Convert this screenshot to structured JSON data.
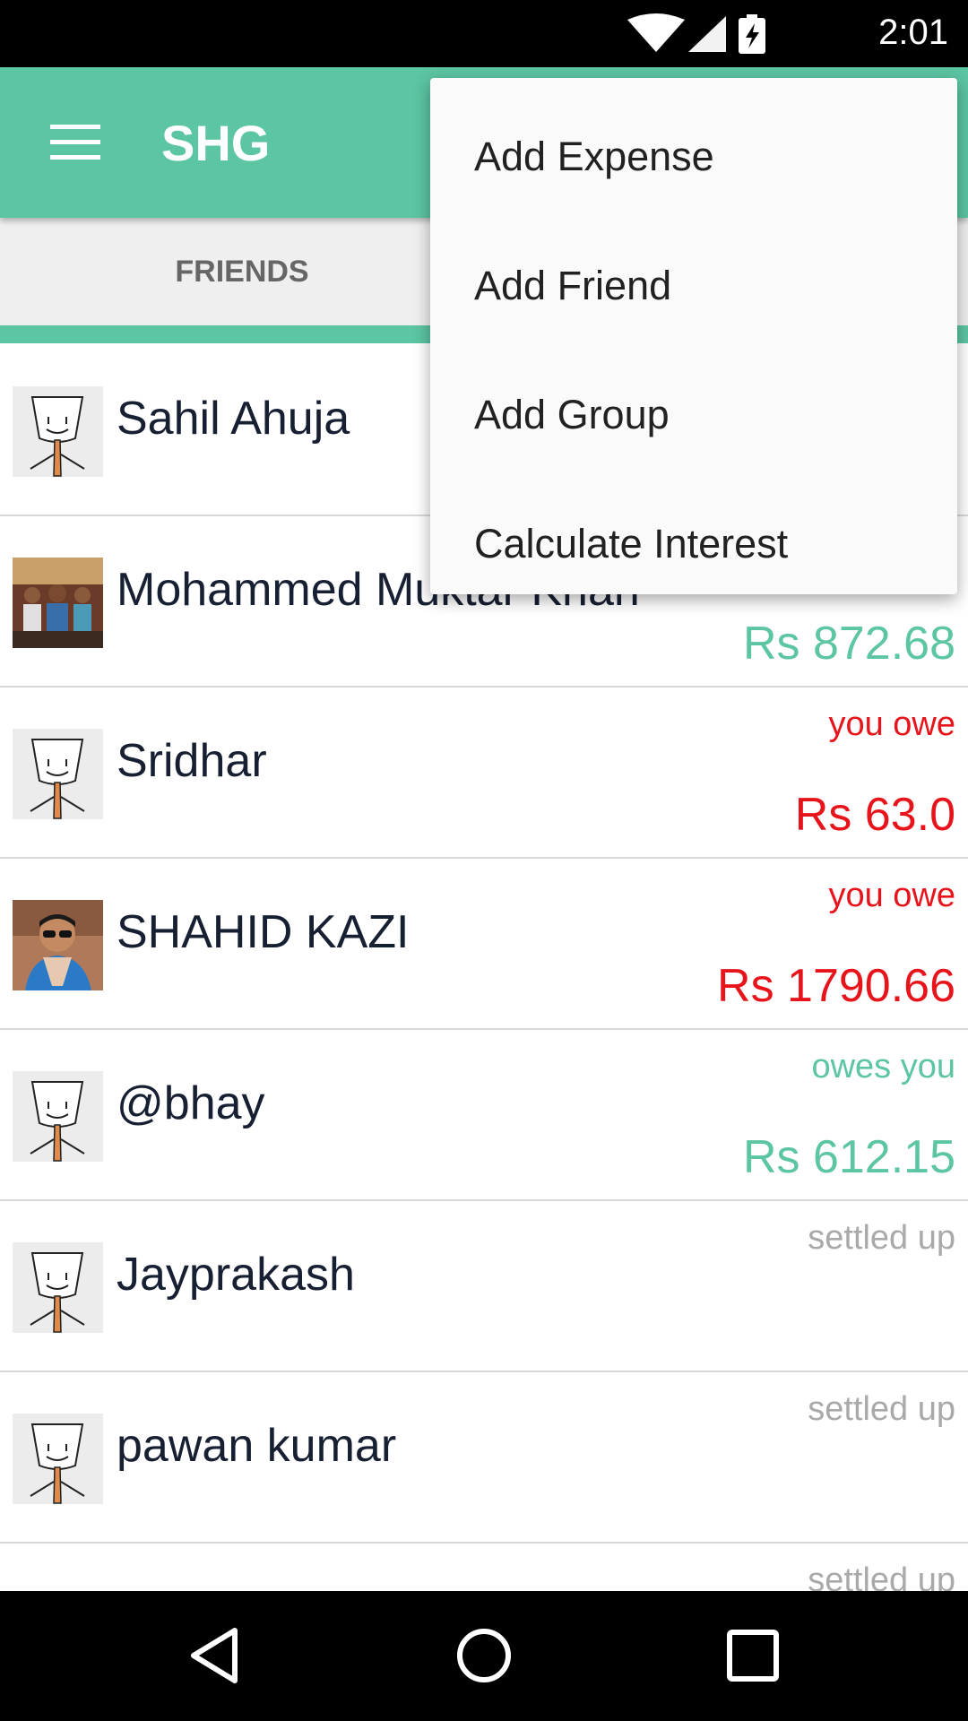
{
  "status_bar": {
    "time": "2:01"
  },
  "app_bar": {
    "title": "SHG",
    "menu_icon": "hamburger-menu-icon"
  },
  "tabs": [
    {
      "label": "FRIENDS",
      "selected": true
    }
  ],
  "friends": [
    {
      "name": "Sahil Ahuja",
      "status": "",
      "amount": "",
      "tone": "none",
      "avatar": "default"
    },
    {
      "name": "Mohammed Muktar Khan",
      "status": "",
      "amount": "Rs 872.68",
      "tone": "positive",
      "avatar": "photo-group"
    },
    {
      "name": "Sridhar",
      "status": "you owe",
      "amount": "Rs 63.0",
      "tone": "negative",
      "avatar": "default"
    },
    {
      "name": "SHAHID KAZI",
      "status": "you owe",
      "amount": "Rs 1790.66",
      "tone": "negative",
      "avatar": "photo-person"
    },
    {
      "name": "@bhay",
      "status": "owes you",
      "amount": "Rs 612.15",
      "tone": "positive",
      "avatar": "default"
    },
    {
      "name": "Jayprakash",
      "status": "settled up",
      "amount": "",
      "tone": "settled",
      "avatar": "default"
    },
    {
      "name": "pawan kumar",
      "status": "settled up",
      "amount": "",
      "tone": "settled",
      "avatar": "default"
    },
    {
      "name": "",
      "status": "settled up",
      "amount": "",
      "tone": "settled",
      "avatar": "default"
    }
  ],
  "popup_menu": {
    "items": [
      "Add Expense",
      "Add Friend",
      "Add Group",
      "Calculate Interest"
    ]
  },
  "colors": {
    "accent": "#5cc5a3",
    "positive": "#5cc5a3",
    "negative": "#e8141b",
    "settled": "#a9a9a9",
    "name": "#172033"
  },
  "nav_bar": {
    "icons": [
      "back-icon",
      "home-icon",
      "recents-icon"
    ]
  }
}
